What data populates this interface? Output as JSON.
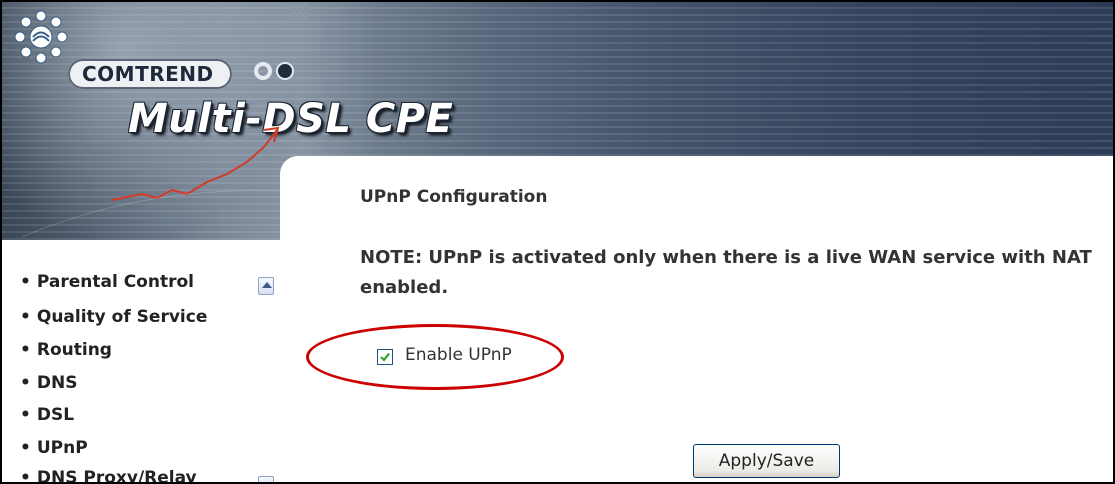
{
  "header": {
    "brand": "COMTREND",
    "product": "Multi-DSL CPE"
  },
  "sidebar": {
    "items": [
      {
        "label": "Parental Control"
      },
      {
        "label": "Quality of Service"
      },
      {
        "label": "Routing"
      },
      {
        "label": "DNS"
      },
      {
        "label": "DSL"
      },
      {
        "label": "UPnP"
      },
      {
        "label": "DNS Proxy/Relay"
      }
    ],
    "bullet": "•"
  },
  "main": {
    "title": "UPnP Configuration",
    "note": "NOTE: UPnP is activated only when there is a live WAN service with NAT enabled.",
    "enable_upnp": {
      "label": "Enable UPnP",
      "checked": true
    },
    "apply_label": "Apply/Save"
  },
  "icons": {
    "logo": "sun-logo-icon",
    "check": "checkmark-icon",
    "scroll_up": "scroll-up-arrow-icon",
    "scroll_down": "scroll-down-arrow-icon"
  },
  "colors": {
    "highlight_ellipse": "#cc0000",
    "check": "#2ea12e",
    "banner": "#3a4a62"
  }
}
